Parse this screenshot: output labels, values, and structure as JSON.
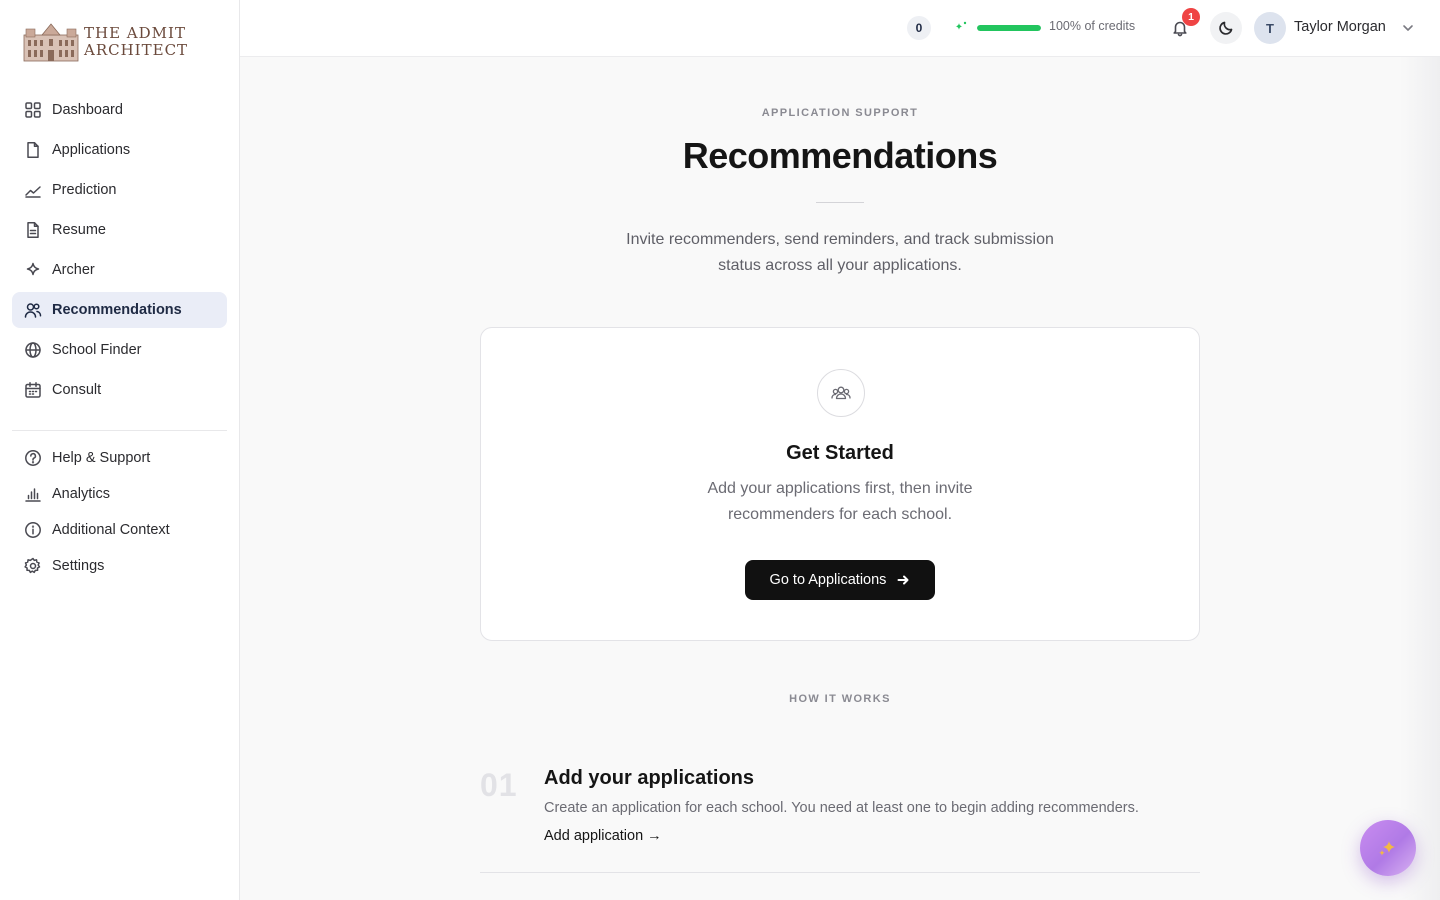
{
  "brand": {
    "line1": "THE ADMIT",
    "line2": "ARCHITECT"
  },
  "sidebar": {
    "primary": [
      {
        "label": "Dashboard",
        "icon": "grid-icon"
      },
      {
        "label": "Applications",
        "icon": "file-icon"
      },
      {
        "label": "Prediction",
        "icon": "trend-icon"
      },
      {
        "label": "Resume",
        "icon": "document-icon"
      },
      {
        "label": "Archer",
        "icon": "sparkle-icon"
      },
      {
        "label": "Recommendations",
        "icon": "users-icon",
        "active": true
      },
      {
        "label": "School Finder",
        "icon": "globe-icon"
      },
      {
        "label": "Consult",
        "icon": "calendar-icon"
      }
    ],
    "secondary": [
      {
        "label": "Help & Support",
        "icon": "help-icon"
      },
      {
        "label": "Analytics",
        "icon": "bar-chart-icon"
      },
      {
        "label": "Additional Context",
        "icon": "info-icon"
      },
      {
        "label": "Settings",
        "icon": "gear-icon"
      }
    ]
  },
  "topbar": {
    "counter": "0",
    "credits_progress": 1.0,
    "credits_text": "100% of credits",
    "notifications": "1",
    "avatar_initial": "T",
    "user_name": "Taylor Morgan"
  },
  "main": {
    "eyebrow": "APPLICATION SUPPORT",
    "title": "Recommendations",
    "subtitle": "Invite recommenders, send reminders, and track submission status across all your applications.",
    "card": {
      "title": "Get Started",
      "description": "Add your applications first, then invite recommenders for each school.",
      "cta": "Go to Applications"
    },
    "how_eyebrow": "HOW IT WORKS",
    "steps": [
      {
        "number": "01",
        "title": "Add your applications",
        "description": "Create an application for each school. You need at least one to begin adding recommenders.",
        "link": "Add application →"
      }
    ]
  },
  "colors": {
    "accent_active_bg": "#eaedf7",
    "credits_bar": "#22c55e",
    "badge": "#ef4444",
    "cta_bg": "#111111"
  }
}
